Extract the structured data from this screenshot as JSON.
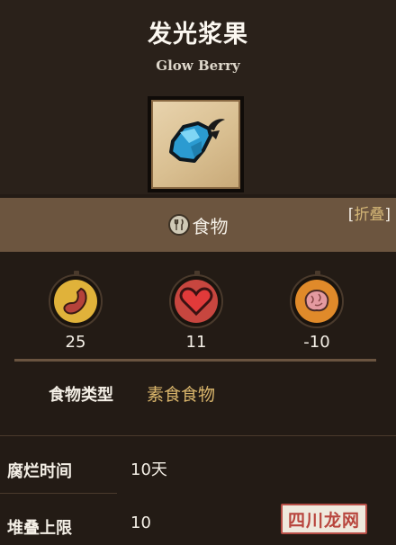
{
  "header": {
    "title": "发光浆果",
    "subtitle": "Glow Berry"
  },
  "item": {
    "icon": "glow-berry-icon"
  },
  "category": {
    "icon": "food-utensils-icon",
    "label": "食物",
    "collapse_open": "[",
    "collapse_label": "折叠",
    "collapse_close": "]"
  },
  "stats": [
    {
      "icon": "hunger-stomach-icon",
      "value": "25",
      "color": "#e0b23a"
    },
    {
      "icon": "health-heart-icon",
      "value": "11",
      "color": "#c7463f"
    },
    {
      "icon": "sanity-brain-icon",
      "value": "-10",
      "color": "#e08a2a"
    }
  ],
  "food_type": {
    "label": "食物类型",
    "value": "素食食物"
  },
  "properties": [
    {
      "label": "腐烂时间",
      "value": "10天"
    },
    {
      "label": "堆叠上限",
      "value": "10"
    }
  ],
  "watermark": {
    "text": "四川龙网"
  }
}
